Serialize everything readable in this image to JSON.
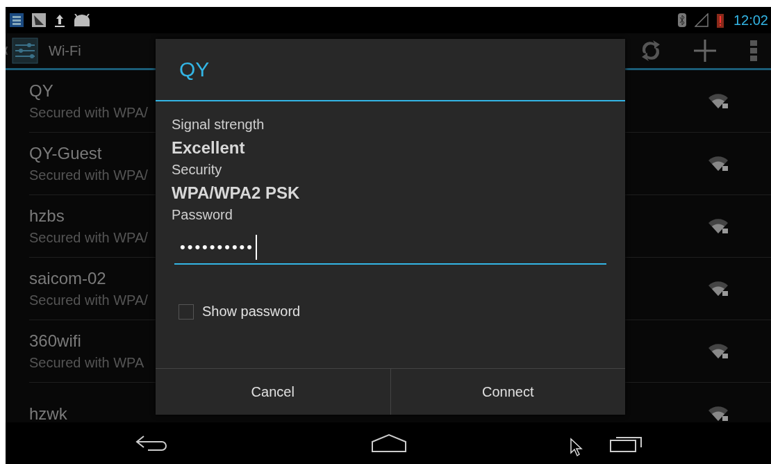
{
  "status_bar": {
    "time": "12:02"
  },
  "action_bar": {
    "title": "Wi-Fi"
  },
  "networks": [
    {
      "name": "QY",
      "security": "Secured with WPA/"
    },
    {
      "name": "QY-Guest",
      "security": "Secured with WPA/"
    },
    {
      "name": "hzbs",
      "security": "Secured with WPA/"
    },
    {
      "name": "saicom-02",
      "security": "Secured with WPA/"
    },
    {
      "name": "360wifi",
      "security": "Secured with WPA"
    },
    {
      "name": "hzwk"
    }
  ],
  "dialog": {
    "title": "QY",
    "fields": [
      {
        "label": "Signal strength",
        "value": "Excellent"
      },
      {
        "label": "Security",
        "value": "WPA/WPA2 PSK"
      }
    ],
    "password": {
      "label": "Password",
      "value": "••••••••••"
    },
    "show_password": {
      "label": "Show password",
      "checked": false
    },
    "buttons": [
      "Cancel",
      "Connect"
    ]
  }
}
